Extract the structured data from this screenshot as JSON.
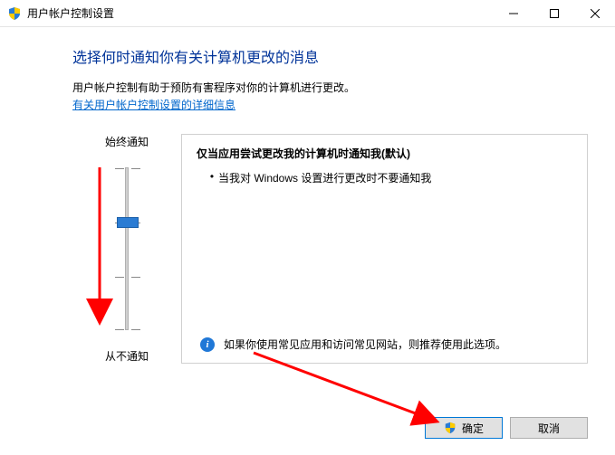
{
  "window": {
    "title": "用户帐户控制设置"
  },
  "heading": "选择何时通知你有关计算机更改的消息",
  "description": "用户帐户控制有助于预防有害程序对你的计算机进行更改。",
  "link_text": "有关用户帐户控制设置的详细信息",
  "slider": {
    "label_top": "始终通知",
    "label_bottom": "从不通知"
  },
  "panel": {
    "title": "仅当应用尝试更改我的计算机时通知我(默认)",
    "items": [
      "当我对 Windows 设置进行更改时不要通知我"
    ],
    "recommendation": "如果你使用常见应用和访问常见网站，则推荐使用此选项。"
  },
  "buttons": {
    "ok": "确定",
    "cancel": "取消"
  }
}
